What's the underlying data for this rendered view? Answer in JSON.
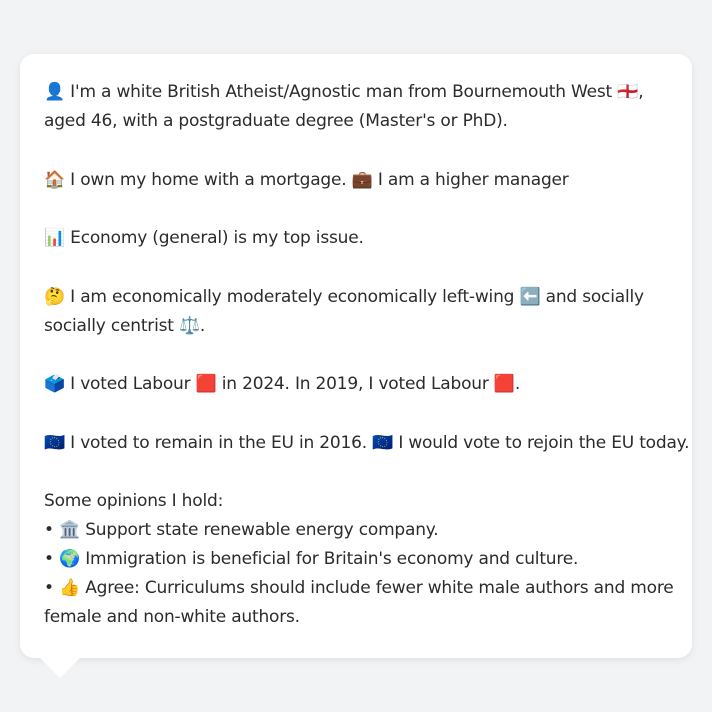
{
  "profile": {
    "identity_line1": "👤 I'm a white British Atheist/Agnostic man from Bournemouth West 🏴󠁧󠁢󠁥󠁮󠁧󠁿,",
    "identity_line2": "aged 46, with a postgraduate degree (Master's or PhD).",
    "housing_line": "🏠 I own my home with a mortgage. 💼 I am a higher manager",
    "top_issue_line": "📊 Economy (general) is my top issue.",
    "ideology_line1": "🤔 I am economically moderately economically left-wing ⬅️ and socially",
    "ideology_line2": "socially centrist ⚖️.",
    "vote_line": "🗳️ I voted Labour 🟥 in 2024. In 2019, I voted Labour 🟥.",
    "eu_line": "🇪🇺 I voted to remain in the EU in 2016. 🇪🇺 I would vote to rejoin the EU today.",
    "opinions_heading": "Some opinions I hold:",
    "opinion1": "• 🏛️ Support state renewable energy company.",
    "opinion2": "• 🌍 Immigration is beneficial for Britain's economy and culture.",
    "opinion3_line1": "• 👍 Agree: Curriculums should include fewer white male authors and more",
    "opinion3_line2": "female and non-white authors."
  }
}
